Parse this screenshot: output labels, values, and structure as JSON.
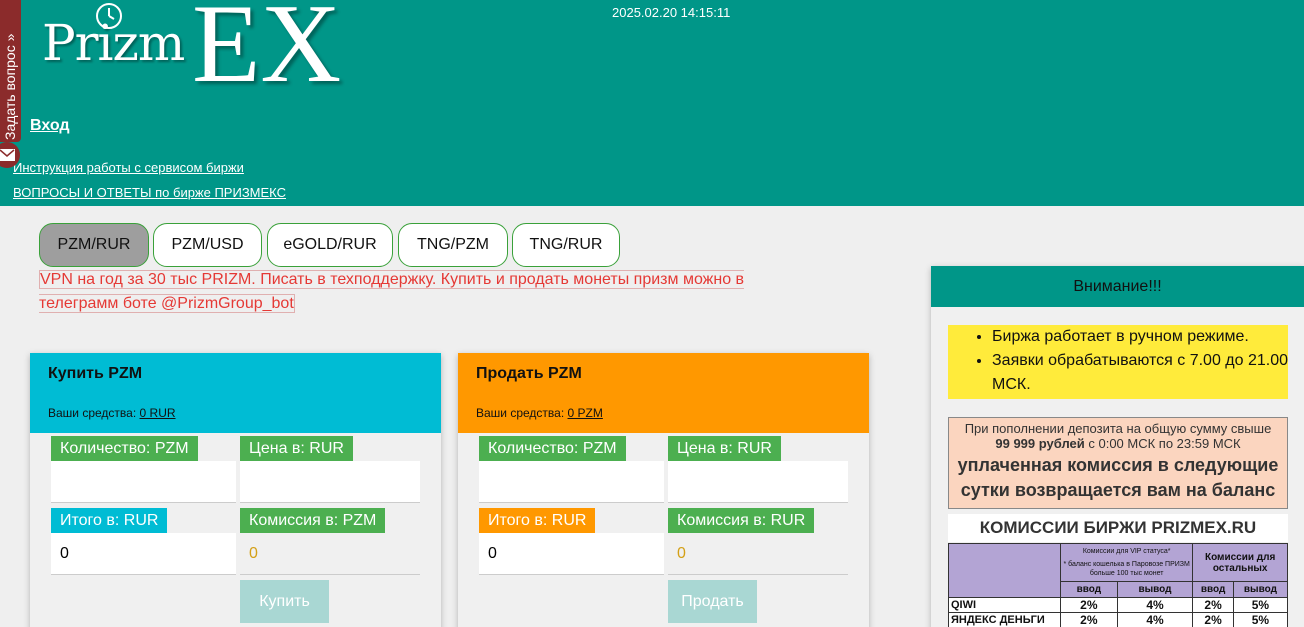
{
  "header": {
    "logo_prizm": "Prizm",
    "logo_ex": "EX",
    "datetime": "2025.02.20 14:15:11",
    "login_label": "Вход",
    "links": [
      "Инструкция работы с сервисом биржи",
      "ВОПРОСЫ И ОТВЕТЫ по бирже ПРИЗМЕКС"
    ]
  },
  "side_tab": {
    "label": "Задать вопрос",
    "arrow": "»"
  },
  "pairs": [
    {
      "label": "PZM/RUR",
      "active": true
    },
    {
      "label": "PZM/USD",
      "active": false
    },
    {
      "label": "eGOLD/RUR",
      "active": false
    },
    {
      "label": "TNG/PZM",
      "active": false
    },
    {
      "label": "TNG/RUR",
      "active": false
    }
  ],
  "notice": "VPN на год за 30 тыс PRIZM. Писать в техподдержку. Купить и продать монеты призм можно в телеграмм боте @PrizmGroup_bot",
  "buy": {
    "title": "Купить PZM",
    "funds_label": "Ваши средства:",
    "funds_value": "0 RUR",
    "qty_label": "Количество: PZM",
    "price_label": "Цена в: RUR",
    "total_label": "Итого в: RUR",
    "total_value": "0",
    "fee_label": "Комиссия в: PZM",
    "fee_value": "0",
    "button": "Купить",
    "color": "#00bcd4"
  },
  "sell": {
    "title": "Продать PZM",
    "funds_label": "Ваши средства:",
    "funds_value": "0 PZM",
    "qty_label": "Количество: PZM",
    "price_label": "Цена в: RUR",
    "total_label": "Итого в: RUR",
    "total_value": "0",
    "fee_label": "Комиссия в: RUR",
    "fee_value": "0",
    "button": "Продать",
    "color": "#ff9800"
  },
  "attention": {
    "title": "Внимание!!!",
    "items": [
      "Биржа работает в ручном режиме.",
      "Заявки обрабатываются с 7.00 до 21.00 МСК."
    ],
    "promo_line1": "При пополнении депозита на общую сумму свыше",
    "promo_line2_bold": "99 999 рублей",
    "promo_line2_rest": " с 0:00 МСК по 23:59 МСК",
    "promo_line3": "уплаченная комиссия в следующие сутки возвращается вам на баланс",
    "commission_title": "КОМИССИИ БИРЖИ PRIZMEX.RU",
    "vip_header": "Комиссии для VIP статуса*",
    "vip_note": "* баланс кошелька в Паровозе ПРИЗМ больше 100 тыс монет",
    "others_header": "Комиссии для остальных",
    "col_in": "ввод",
    "col_out": "вывод",
    "rows": [
      {
        "name": "QIWI",
        "vip_in": "2%",
        "vip_out": "4%",
        "oth_in": "2%",
        "oth_out": "5%"
      },
      {
        "name": "ЯНДЕКС ДЕНЬГИ",
        "vip_in": "2%",
        "vip_out": "4%",
        "oth_in": "2%",
        "oth_out": "5%"
      }
    ]
  },
  "colors": {
    "header_bg": "#009688",
    "label_green": "#4caf50",
    "buy_accent": "#00bcd4",
    "sell_accent": "#ff9800",
    "notice_red": "#e53935",
    "attention_yellow": "#ffeb3b"
  }
}
